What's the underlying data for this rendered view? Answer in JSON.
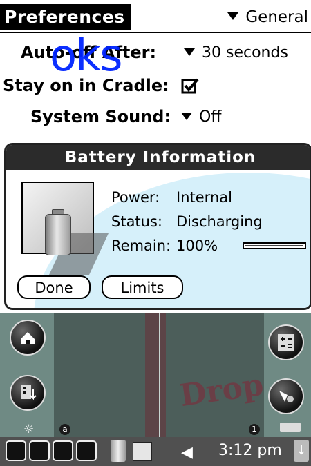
{
  "app": {
    "title": "Preferences",
    "category": "General"
  },
  "prefs": {
    "auto_off_label": "Auto-off After:",
    "auto_off_value": "30 seconds",
    "stay_on_label": "Stay on in Cradle:",
    "stay_on_checked": true,
    "system_sound_label": "System Sound:",
    "system_sound_value": "Off"
  },
  "overlay": {
    "watermark": "oks",
    "launcher_text": "Drop"
  },
  "dialog": {
    "title": "Battery Information",
    "power_label": "Power:",
    "power_value": "Internal",
    "status_label": "Status:",
    "status_value": "Discharging",
    "remain_label": "Remain:",
    "remain_value": "100%",
    "remain_fraction": 1.0,
    "done_label": "Done",
    "limits_label": "Limits"
  },
  "launcher": {
    "left_marker": "a",
    "right_marker": "1",
    "icons": [
      "home-icon",
      "applications-icon",
      "calculator-icon",
      "find-icon"
    ]
  },
  "statusbar": {
    "time": "3:12 pm",
    "icons": [
      "home-icon",
      "applications-icon",
      "find-icon",
      "menu-icon",
      "battery-icon",
      "copy-icon",
      "speaker-icon",
      "input-area-icon"
    ]
  }
}
